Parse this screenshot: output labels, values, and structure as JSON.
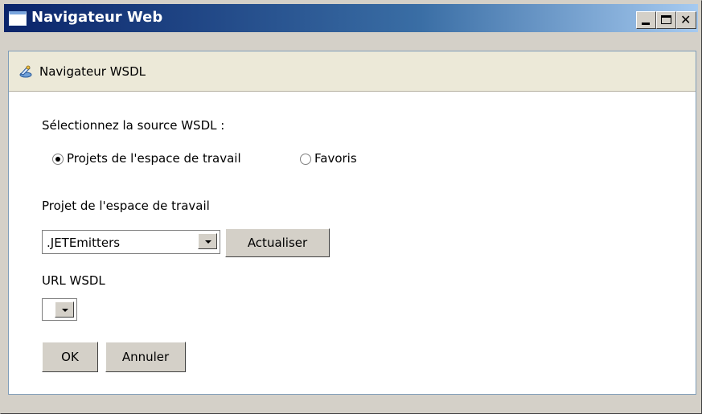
{
  "window": {
    "title": "Navigateur Web"
  },
  "header": {
    "title": "Navigateur WSDL",
    "icon": "wsdl-browser-icon"
  },
  "source": {
    "label": "Sélectionnez la source WSDL :",
    "options": [
      {
        "label": "Projets de l'espace de travail",
        "selected": true
      },
      {
        "label": "Favoris",
        "selected": false
      }
    ]
  },
  "project": {
    "label": "Projet de l'espace de travail",
    "selected": ".JETEmitters",
    "refresh_label": "Actualiser"
  },
  "wsdl_url": {
    "label": "URL WSDL",
    "selected": ""
  },
  "actions": {
    "ok_label": "OK",
    "cancel_label": "Annuler"
  }
}
